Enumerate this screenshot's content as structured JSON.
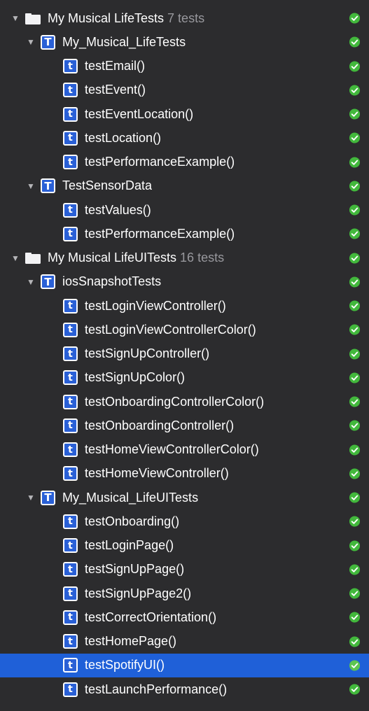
{
  "colors": {
    "background": "#2c2c2e",
    "selected_row": "#1f60d8",
    "pass_check": "#42b83c",
    "badge_blue": "#2a60d6",
    "count_text": "#98989d"
  },
  "icons": {
    "disclosure": "disclosure-triangle-open-icon",
    "bundle": "folder-icon",
    "class_badge": "T",
    "method_badge": "t",
    "status": "test-passed-icon"
  },
  "tree": {
    "bundles": [
      {
        "name": "My Musical LifeTests",
        "count": "7 tests",
        "classes": [
          {
            "name": "My_Musical_LifeTests",
            "tests": [
              "testEmail()",
              "testEvent()",
              "testEventLocation()",
              "testLocation()",
              "testPerformanceExample()"
            ]
          },
          {
            "name": "TestSensorData",
            "tests": [
              "testValues()",
              "testPerformanceExample()"
            ]
          }
        ]
      },
      {
        "name": "My Musical LifeUITests",
        "count": "16 tests",
        "classes": [
          {
            "name": "iosSnapshotTests",
            "tests": [
              "testLoginViewController()",
              "testLoginViewControllerColor()",
              "testSignUpController()",
              "testSignUpColor()",
              "testOnboardingControllerColor()",
              "testOnboardingController()",
              "testHomeViewControllerColor()",
              "testHomeViewController()"
            ]
          },
          {
            "name": "My_Musical_LifeUITests",
            "tests": [
              "testOnboarding()",
              "testLoginPage()",
              "testSignUpPage()",
              "testSignUpPage2()",
              "testCorrectOrientation()",
              "testHomePage()",
              "testSpotifyUI()",
              "testLaunchPerformance()"
            ]
          }
        ]
      }
    ],
    "selected_test": "testSpotifyUI()"
  }
}
